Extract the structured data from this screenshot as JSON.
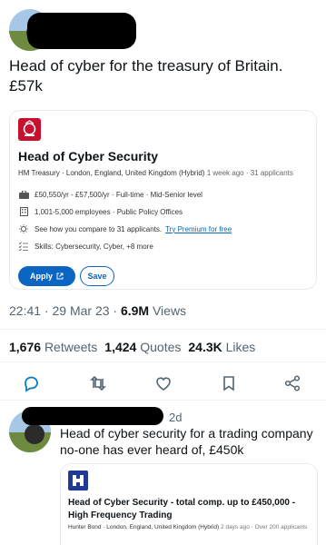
{
  "main_tweet": {
    "text": "Head of cyber for the treasury of Britain. £57k",
    "timestamp": "22:41 · 29 Mar 23 · ",
    "views_count": "6.9M",
    "views_label": " Views"
  },
  "job_card": {
    "logo_icon": "uk-government-crest-icon",
    "title": "Head of Cyber Security",
    "company": "HM Treasury",
    "location": "London, England, United Kingdom (Hybrid)",
    "posted": "1 week ago",
    "applicants": "31 applicants",
    "salary_line": "£50,550/yr - £57,500/yr · Full-time · Mid-Senior level",
    "company_size_line": "1,001-5,000 employees · Public Policy Offices",
    "compare_text": "See how you compare to 31 applicants.",
    "premium_link": "Try Premium for free",
    "skills_line": "Skills: Cybersecurity, Cyber, +8 more",
    "apply_label": "Apply",
    "save_label": "Save"
  },
  "stats": {
    "retweets_count": "1,676",
    "retweets_label": "Retweets",
    "quotes_count": "1,424",
    "quotes_label": "Quotes",
    "likes_count": "24.3K",
    "likes_label": "Likes"
  },
  "actions": [
    "reply-icon",
    "retweet-icon",
    "like-icon",
    "bookmark-icon",
    "share-icon"
  ],
  "reply_tweet": {
    "time": "2d",
    "text": "Head of cyber security for a trading company no-one has ever heard of, £450k",
    "card": {
      "title": "Head of Cyber Security - total comp. up to £450,000 - High Frequency Trading",
      "company": "Hunter Bond",
      "location": "London, England, United Kingdom (Hybrid)",
      "posted": "2 days ago",
      "applicants": "Over 200 applicants"
    }
  },
  "colors": {
    "link": "#0a66c2",
    "muted": "#536471",
    "redaction": "#000000"
  }
}
